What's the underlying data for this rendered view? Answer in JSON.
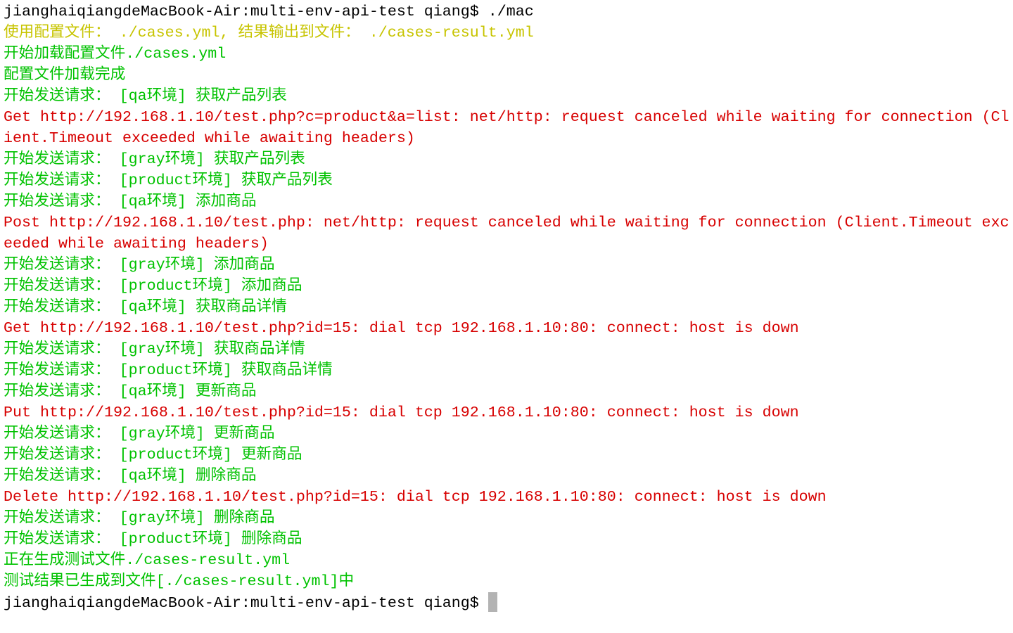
{
  "colors": {
    "prompt": "#000000",
    "info": "#c7c400",
    "ok": "#00c200",
    "error": "#d70000",
    "cursor": "#b3b3b3"
  },
  "terminal": {
    "lines": [
      {
        "type": "prompt",
        "text": "jianghaiqiangdeMacBook-Air:multi-env-api-test qiang$ ./mac"
      },
      {
        "type": "info",
        "text": "使用配置文件： ./cases.yml, 结果输出到文件： ./cases-result.yml"
      },
      {
        "type": "ok",
        "text": "开始加载配置文件./cases.yml"
      },
      {
        "type": "ok",
        "text": "配置文件加载完成"
      },
      {
        "type": "ok",
        "text": "开始发送请求： [qa环境] 获取产品列表"
      },
      {
        "type": "error",
        "text": "Get http://192.168.1.10/test.php?c=product&a=list: net/http: request canceled while waiting for connection (Client.Timeout exceeded while awaiting headers)"
      },
      {
        "type": "ok",
        "text": "开始发送请求： [gray环境] 获取产品列表"
      },
      {
        "type": "ok",
        "text": "开始发送请求： [product环境] 获取产品列表"
      },
      {
        "type": "ok",
        "text": "开始发送请求： [qa环境] 添加商品"
      },
      {
        "type": "error",
        "text": "Post http://192.168.1.10/test.php: net/http: request canceled while waiting for connection (Client.Timeout exceeded while awaiting headers)"
      },
      {
        "type": "ok",
        "text": "开始发送请求： [gray环境] 添加商品"
      },
      {
        "type": "ok",
        "text": "开始发送请求： [product环境] 添加商品"
      },
      {
        "type": "ok",
        "text": "开始发送请求： [qa环境] 获取商品详情"
      },
      {
        "type": "error",
        "text": "Get http://192.168.1.10/test.php?id=15: dial tcp 192.168.1.10:80: connect: host is down"
      },
      {
        "type": "ok",
        "text": "开始发送请求： [gray环境] 获取商品详情"
      },
      {
        "type": "ok",
        "text": "开始发送请求： [product环境] 获取商品详情"
      },
      {
        "type": "ok",
        "text": "开始发送请求： [qa环境] 更新商品"
      },
      {
        "type": "error",
        "text": "Put http://192.168.1.10/test.php?id=15: dial tcp 192.168.1.10:80: connect: host is down"
      },
      {
        "type": "ok",
        "text": "开始发送请求： [gray环境] 更新商品"
      },
      {
        "type": "ok",
        "text": "开始发送请求： [product环境] 更新商品"
      },
      {
        "type": "ok",
        "text": "开始发送请求： [qa环境] 删除商品"
      },
      {
        "type": "error",
        "text": "Delete http://192.168.1.10/test.php?id=15: dial tcp 192.168.1.10:80: connect: host is down"
      },
      {
        "type": "ok",
        "text": "开始发送请求： [gray环境] 删除商品"
      },
      {
        "type": "ok",
        "text": "开始发送请求： [product环境] 删除商品"
      },
      {
        "type": "ok",
        "text": "正在生成测试文件./cases-result.yml"
      },
      {
        "type": "ok",
        "text": "测试结果已生成到文件[./cases-result.yml]中"
      }
    ],
    "final_prompt": "jianghaiqiangdeMacBook-Air:multi-env-api-test qiang$"
  }
}
